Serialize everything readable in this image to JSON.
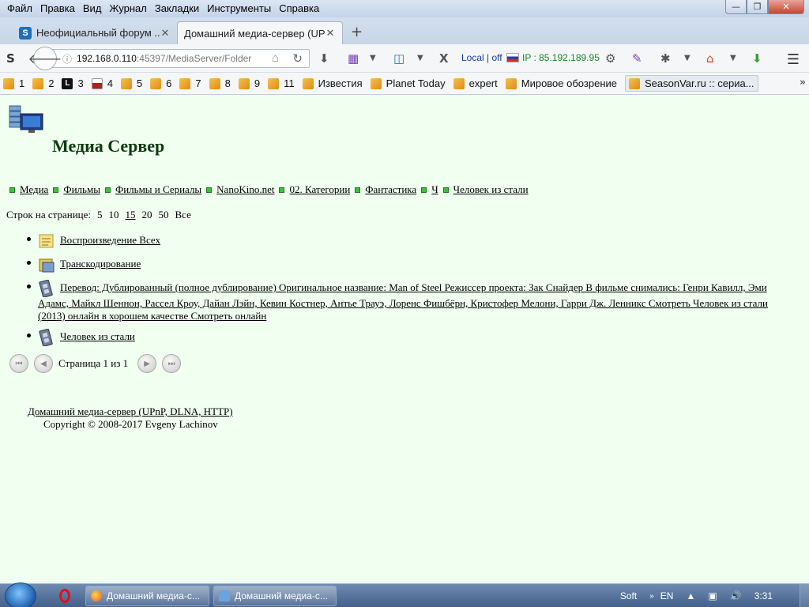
{
  "menu": [
    {
      "label": "Файл",
      "key": "Ф"
    },
    {
      "label": "Правка",
      "key": "П"
    },
    {
      "label": "Вид",
      "key": "В"
    },
    {
      "label": "Журнал",
      "key": "Ж"
    },
    {
      "label": "Закладки",
      "key": "З"
    },
    {
      "label": "Инструменты",
      "key": "И"
    },
    {
      "label": "Справка",
      "key": "С"
    }
  ],
  "tabs": [
    {
      "title": "Неофициальный форум ..."
    },
    {
      "title": "Домашний медиа-сервер (UP..."
    }
  ],
  "url": {
    "host": "192.168.0.110",
    "rest": ":45397/MediaServer/Folder"
  },
  "toolbar": {
    "local_status": "Local | off",
    "ip_text": "IP : 85.192.189.95"
  },
  "bookmarks": [
    {
      "label": "1",
      "icon": "rss-icon"
    },
    {
      "label": "2",
      "icon": "rss-icon"
    },
    {
      "label": "3",
      "icon": "l-icon"
    },
    {
      "label": "4",
      "icon": "doc-icon"
    },
    {
      "label": "5",
      "icon": "rss-icon"
    },
    {
      "label": "6",
      "icon": "rss-icon"
    },
    {
      "label": "7",
      "icon": "rss-icon"
    },
    {
      "label": "8",
      "icon": "rss-icon"
    },
    {
      "label": "9",
      "icon": "rss-icon"
    },
    {
      "label": "11",
      "icon": "rss-icon"
    },
    {
      "label": "Известия",
      "icon": "rss-icon"
    },
    {
      "label": "Planet Today",
      "icon": "rss-icon"
    },
    {
      "label": "expert",
      "icon": "rss-icon"
    },
    {
      "label": "Мировое обозрение",
      "icon": "rss-icon"
    },
    {
      "label": "SeasonVar.ru :: сериа...",
      "icon": "rss-icon"
    }
  ],
  "page": {
    "title": "Медиа Сервер",
    "breadcrumbs": [
      "Медиа",
      "Фильмы",
      "Фильмы и Сериалы",
      "NanoKino.net",
      "02. Категории",
      "Фантастика",
      "Ч",
      "Человек из стали"
    ],
    "rows_label": "Строк на странице:",
    "rows_options": [
      "5",
      "10",
      "15",
      "20",
      "50",
      "Все"
    ],
    "rows_selected": "15",
    "items": [
      {
        "label": "Воспроизведение Всех",
        "icon": "playlist-icon"
      },
      {
        "label": "Транскодирование",
        "icon": "transcode-icon"
      },
      {
        "label": "Перевод: Дублированный (полное дублирование) Оригинальное название: Man of Steel Режиссер проекта: Зак Снайдер В фильме снимались: Генри Кавилл, Эми Адамс, Майкл Шеннон, Рассел Кроу, Дайан Лэйн, Кевин Костнер, Антье Трауэ, Лоренс Фишбёрн, Кристофер Мелони, Гарри Дж. Ленникс Смотреть Человек из стали (2013) онлайн в хорошем качестве Смотреть онлайн",
        "icon": "film-icon"
      },
      {
        "label": "Человек из стали",
        "icon": "film-icon"
      }
    ],
    "pager_text": "Страница 1 из 1",
    "footer_link": "Домашний медиа-сервер (UPnP, DLNA, HTTP)",
    "footer_copy": "Copyright © 2008-2017 Evgeny Lachinov"
  },
  "taskbar": {
    "items": [
      "Домашний медиа-с...",
      "Домашний медиа-с..."
    ],
    "lang_soft": "Soft",
    "lang": "EN",
    "time": "3:31"
  }
}
